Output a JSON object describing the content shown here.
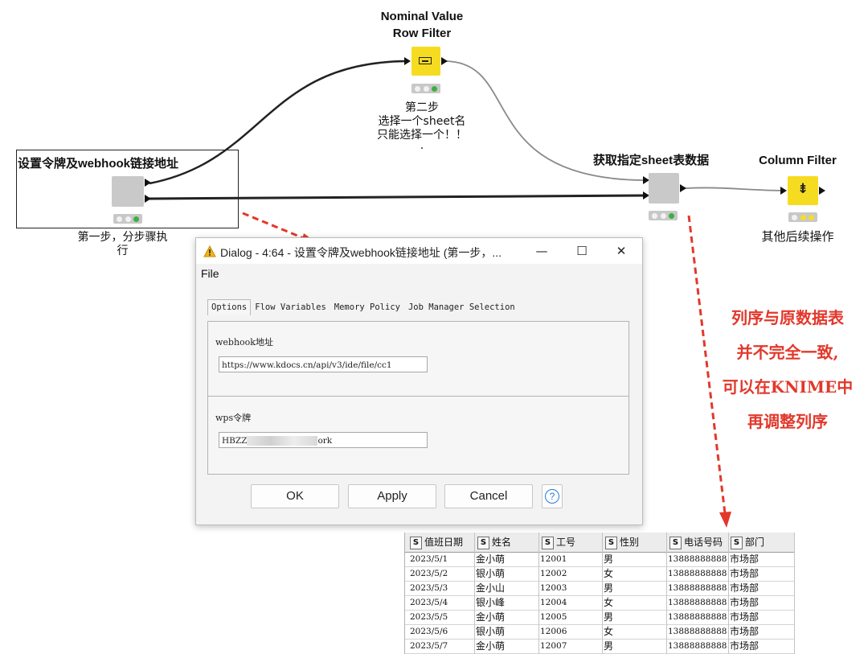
{
  "workflow": {
    "nodes": [
      {
        "id": "token",
        "title": "设置令牌及webhook链接地址",
        "caption": [
          "第一步，分步骤执",
          "行"
        ],
        "status": "green"
      },
      {
        "id": "nominal",
        "title": [
          "Nominal Value",
          "Row Filter"
        ],
        "caption": [
          "第二步",
          "选择一个sheet名",
          "只能选择一个！！",
          "."
        ],
        "status": "green"
      },
      {
        "id": "fetch",
        "title": "获取指定sheet表数据",
        "caption": [],
        "status": "green"
      },
      {
        "id": "colfilter",
        "title": "Column Filter",
        "caption": [
          "其他后续操作"
        ],
        "status": "yellow"
      }
    ],
    "annotation": [
      "列序与原数据表",
      "并不完全一致,",
      "可以在KNIME中",
      "再调整列序"
    ],
    "colors": {
      "node_yellow": "#f6dc21",
      "node_gray": "#c9c9c9",
      "status_green": "#3cb043",
      "annot_red": "#e2382b"
    }
  },
  "dialog": {
    "title": "Dialog - 4:64 - 设置令牌及webhook链接地址 (第一步，...",
    "window_buttons": {
      "minimize": "—",
      "maximize": "☐",
      "close": "✕"
    },
    "menu": [
      "File"
    ],
    "tabs": [
      "Options",
      "Flow Variables",
      "Memory Policy",
      "Job Manager Selection"
    ],
    "active_tab": "Options",
    "fields": [
      {
        "label": "webhook地址",
        "value": "https://www.kdocs.cn/api/v3/ide/file/cc1"
      },
      {
        "label": "wps令牌",
        "value_prefix": "HBZZ",
        "value_suffix": "ork"
      }
    ],
    "buttons": {
      "ok": "OK",
      "apply": "Apply",
      "cancel": "Cancel",
      "help": "?"
    }
  },
  "table": {
    "type_badge": "S",
    "headers": [
      "值班日期",
      "姓名",
      "工号",
      "性别",
      "电话号码",
      "部门"
    ],
    "rows": [
      [
        "2023/5/1",
        "金小萌",
        "12001",
        "男",
        "13888888888",
        "市场部"
      ],
      [
        "2023/5/2",
        "银小萌",
        "12002",
        "女",
        "13888888888",
        "市场部"
      ],
      [
        "2023/5/3",
        "金小山",
        "12003",
        "男",
        "13888888888",
        "市场部"
      ],
      [
        "2023/5/4",
        "银小峰",
        "12004",
        "女",
        "13888888888",
        "市场部"
      ],
      [
        "2023/5/5",
        "金小萌",
        "12005",
        "男",
        "13888888888",
        "市场部"
      ],
      [
        "2023/5/6",
        "银小萌",
        "12006",
        "女",
        "13888888888",
        "市场部"
      ],
      [
        "2023/5/7",
        "金小萌",
        "12007",
        "男",
        "13888888888",
        "市场部"
      ]
    ]
  }
}
